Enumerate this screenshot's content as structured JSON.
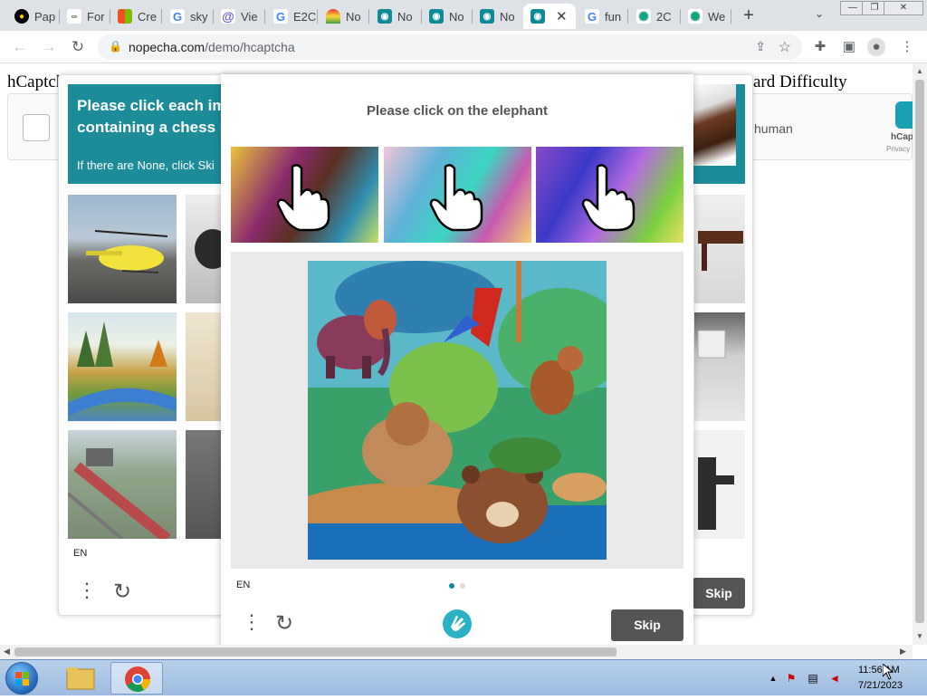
{
  "browser": {
    "tabs": [
      {
        "label": "Pap",
        "icon": "pacman-icon",
        "color": "#000000"
      },
      {
        "label": "For",
        "icon": "infinity-icon",
        "color": "#888888"
      },
      {
        "label": "Cre",
        "icon": "microsoft-icon",
        "color": "#f25022"
      },
      {
        "label": "sky",
        "icon": "google-icon",
        "color": "#4285f4"
      },
      {
        "label": "Vie",
        "icon": "at-icon",
        "color": "#6a5acd"
      },
      {
        "label": "E2C",
        "icon": "google-icon",
        "color": "#4285f4"
      },
      {
        "label": "No",
        "icon": "rainbow-icon",
        "color": "#e8a020"
      },
      {
        "label": "No",
        "icon": "robot-icon",
        "color": "#0f8a97"
      },
      {
        "label": "No",
        "icon": "robot-icon",
        "color": "#0f8a97"
      },
      {
        "label": "No",
        "icon": "robot-icon",
        "color": "#0f8a97"
      },
      {
        "label": "",
        "icon": "robot-icon",
        "color": "#0f8a97",
        "active": true
      },
      {
        "label": "fun",
        "icon": "google-icon",
        "color": "#4285f4"
      },
      {
        "label": "2C",
        "icon": "openai-icon",
        "color": "#10a37f"
      },
      {
        "label": "We",
        "icon": "openai-icon",
        "color": "#10a37f"
      }
    ],
    "new_tab": "+",
    "url_host": "nopecha.com",
    "url_path": "/demo/hcaptcha"
  },
  "page": {
    "heading_left": "hCaptcha",
    "heading_right": "ard Difficulty",
    "widget_text": "human",
    "widget_brand": "hCap",
    "widget_privacy": "Privacy"
  },
  "back_challenge": {
    "prompt": "Please click each image containing a chess piece",
    "prompt_visible": "Please click each im containing a chess p",
    "subtext": "If there are None, click Ski",
    "lang": "EN",
    "skip": "Skip"
  },
  "front_challenge": {
    "prompt": "Please click on the elephant",
    "lang": "EN",
    "skip": "Skip",
    "page_indicator": {
      "current": 1,
      "total": 2
    }
  },
  "taskbar": {
    "time": "11:56 AM",
    "date": "7/21/2023"
  },
  "colors": {
    "accent": "#1c8c98",
    "skip_button": "#555555"
  }
}
